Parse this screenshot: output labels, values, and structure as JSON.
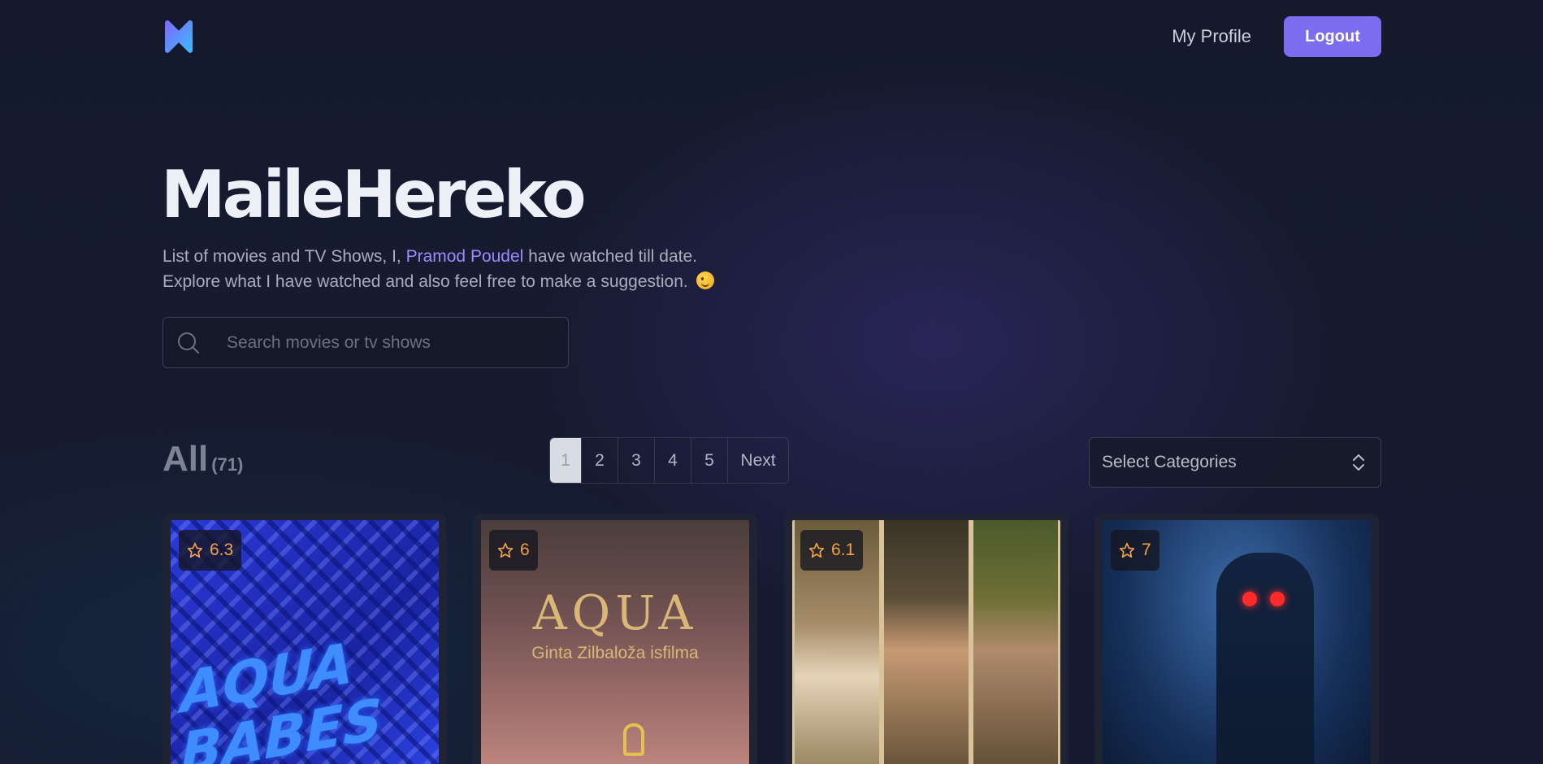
{
  "header": {
    "logo_icon": "m-logo-icon",
    "profile_label": "My Profile",
    "logout_label": "Logout",
    "accent_color": "#7c6cf0"
  },
  "hero": {
    "title": "MaileHereko",
    "intro_prefix": "List of movies and TV Shows, I, ",
    "intro_name": "Pramod Poudel",
    "intro_suffix": " have watched till date.",
    "intro_line2": "Explore what I have watched and also feel free to make a suggestion.",
    "emoji_icon": "winking-face-icon"
  },
  "search": {
    "placeholder": "Search movies or tv shows",
    "value": ""
  },
  "listing": {
    "section_title": "All",
    "count": "(71)",
    "pages": [
      "1",
      "2",
      "3",
      "4",
      "5"
    ],
    "active_page": "1",
    "next_label": "Next",
    "category_placeholder": "Select Categories"
  },
  "cards": [
    {
      "rating": "6.3",
      "poster_text": "AQUA BABES"
    },
    {
      "rating": "6",
      "poster_text": "AQUA",
      "poster_subtext": "Ginta Zilbaloža isfilma"
    },
    {
      "rating": "6.1"
    },
    {
      "rating": "7"
    }
  ],
  "colors": {
    "rating": "#f5a14a",
    "highlight_name": "#9a8cff"
  }
}
